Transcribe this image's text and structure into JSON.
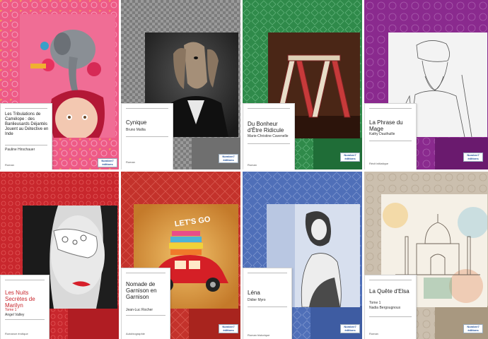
{
  "covers": [
    {
      "title": "Les Tribulations de Camélope : des Banlieusards Déjantés Jouent au Détective en Inde",
      "author": "Pauline Hirschauer",
      "genre": "Roman",
      "publisher": "Nombre7 éditions",
      "colors": {
        "frame": "#ee5a86",
        "accent": "#f4a3bf"
      }
    },
    {
      "title": "Cynique",
      "author": "Bruno Mallia",
      "genre": "Roman",
      "publisher": "Nombre7 éditions",
      "colors": {
        "frame": "#8e8e8e",
        "accent": "#6b6b6b"
      }
    },
    {
      "title": "Du Bonheur d'Être Ridicule",
      "author": "Marie-Christine Cavenelle",
      "genre": "Roman",
      "publisher": "Nombre7 éditions",
      "colors": {
        "frame": "#2f8a4a",
        "accent": "#1e6b36"
      }
    },
    {
      "title": "La Phrase du Mage",
      "author": "Kathy Dauthuille",
      "genre": "Récit initiatique",
      "publisher": "Nombre7 éditions",
      "colors": {
        "frame": "#8a2a8e",
        "accent": "#6a1a6e"
      }
    },
    {
      "title": "Les Nuits Secrètes de Marilyn",
      "subtitle": "Tome 1",
      "author": "Angel Valley",
      "genre": "Romance érotique",
      "publisher": "Nombre7 éditions",
      "colors": {
        "frame": "#c8272d",
        "accent": "#e94747"
      }
    },
    {
      "title": "Nomade de Garnison en Garnison",
      "author": "Jean-Luc Rocher",
      "genre": "Autobiographie",
      "publisher": "Nombre7 éditions",
      "colors": {
        "frame": "#c3322b",
        "accent": "#e8a04a"
      }
    },
    {
      "title": "Léna",
      "author": "Didier Myro",
      "genre": "Roman historique",
      "publisher": "Nombre7 éditions",
      "colors": {
        "frame": "#4f6fb8",
        "accent": "#9ab0d8"
      }
    },
    {
      "title": "La Quête d'Elsa",
      "subtitle": "Tome 1",
      "author": "Nadia Bergougnoux",
      "genre": "Roman",
      "publisher": "Nombre7 éditions",
      "colors": {
        "frame": "#c7b9a6",
        "accent": "#a89880"
      }
    }
  ],
  "icons": [
    "elephant-collage-art",
    "saluki-dog-suit-art",
    "card-house-art",
    "wizard-sketch-art",
    "lace-mask-woman-art",
    "red-car-luggage-art",
    "woman-sketch-art",
    "taj-mahal-watercolor-art"
  ],
  "art_text": {
    "lets_go": "LET'S GO"
  }
}
